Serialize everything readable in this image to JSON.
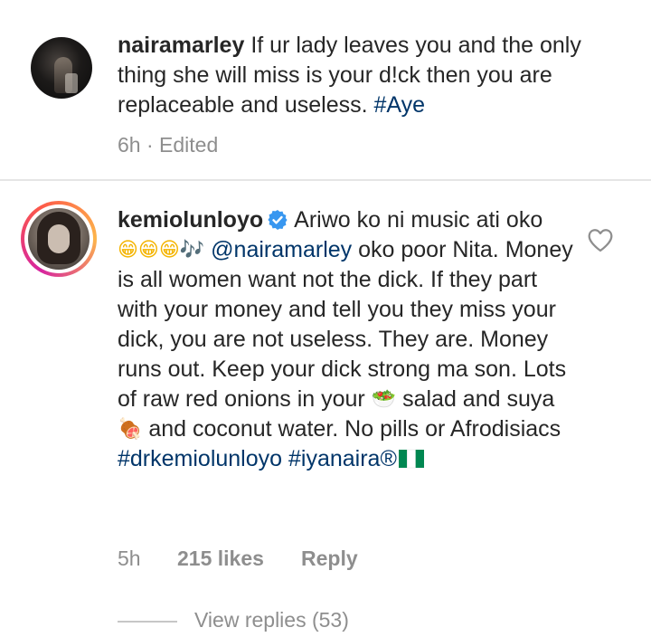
{
  "comments": [
    {
      "username": "nairamarley",
      "text": "If ur lady leaves you and the only thing she will miss is your d!ck then you are replaceable and useless.",
      "hashtag": "#Aye",
      "time": "6h",
      "separator": "·",
      "edited": "Edited"
    },
    {
      "username": "kemiolunloyo",
      "text_1": "Ariwo ko ni music ati oko",
      "emoji_1": "😁😁😁",
      "emoji_2": "🎶",
      "mention": "@nairamarley",
      "text_2": "oko poor Nita. Money is all women want not the dick. If they part with your money and tell you they miss your dick, you are not useless. They are. Money runs out. Keep your dick strong ma son. Lots of raw red onions in your",
      "emoji_3": "🥗",
      "text_3": "salad and suya",
      "emoji_4": "🍖",
      "text_4": "and coconut water. No pills or Afrodisiacs",
      "hashtag_1": "#drkemiolunloyo",
      "hashtag_2": "#iyanaira®",
      "time": "5h",
      "likes": "215 likes",
      "reply_label": "Reply",
      "view_replies": "View replies (53)"
    }
  ],
  "colors": {
    "text": "#262626",
    "meta": "#8e8e8e",
    "link": "#003569",
    "verified": "#3897f0",
    "divider": "#e5e5e5"
  },
  "icons": {
    "verified": "verified-badge-icon",
    "like": "heart-outline-icon",
    "flag": "nigeria-flag-emoji"
  }
}
